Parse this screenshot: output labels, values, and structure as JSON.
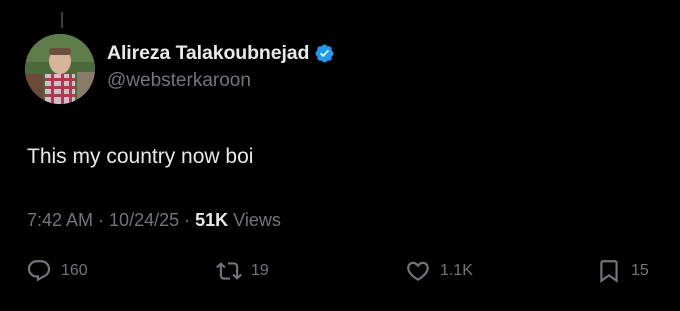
{
  "author": {
    "display_name": "Alireza Talakoubnejad",
    "handle": "@websterkaroon",
    "verified": true
  },
  "tweet": {
    "text": "This my country now boi"
  },
  "meta": {
    "time": "7:42 AM",
    "date": "10/24/25",
    "separator": "·",
    "views_count": "51K",
    "views_label": "Views"
  },
  "actions": {
    "replies": "160",
    "retweets": "19",
    "likes": "1.1K",
    "bookmarks": "15"
  },
  "colors": {
    "background": "#000000",
    "primary_text": "#e7e9ea",
    "secondary_text": "#71767b",
    "verified_blue": "#1d9bf0"
  },
  "icons": {
    "reply": "reply-icon",
    "retweet": "retweet-icon",
    "like": "heart-icon",
    "bookmark": "bookmark-icon",
    "verified": "verified-badge-icon"
  }
}
